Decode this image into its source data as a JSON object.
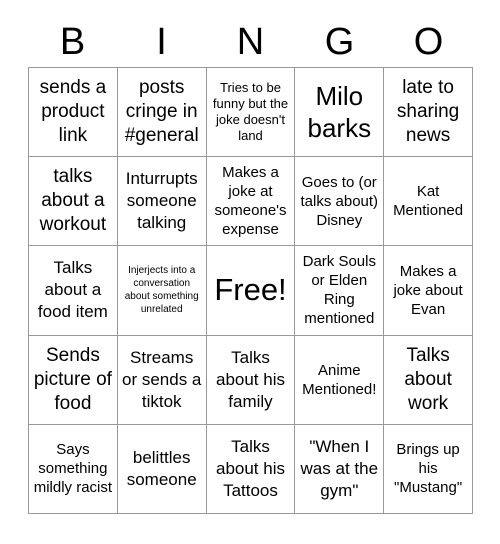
{
  "header": {
    "letters": [
      "B",
      "I",
      "N",
      "G",
      "O"
    ]
  },
  "grid": {
    "rows": 5,
    "columns": 5,
    "border_color": "#999999",
    "cell_background": "#ffffff",
    "text_color": "#000000",
    "cells": [
      {
        "text": "sends a product link",
        "size": "xl"
      },
      {
        "text": "posts cringe in #general",
        "size": "xl"
      },
      {
        "text": "Tries to be funny but the joke doesn't land",
        "size": "sm"
      },
      {
        "text": "Milo barks",
        "size": "xxl"
      },
      {
        "text": "late to sharing news",
        "size": "xl"
      },
      {
        "text": "talks about a workout",
        "size": "xl"
      },
      {
        "text": "Inturrupts someone talking",
        "size": "lg"
      },
      {
        "text": "Makes a joke at someone's expense",
        "size": "md"
      },
      {
        "text": "Goes to (or talks about) Disney",
        "size": "md"
      },
      {
        "text": "Kat Mentioned",
        "size": "md"
      },
      {
        "text": "Talks about a food item",
        "size": "lg"
      },
      {
        "text": "Injerjects into a conversation about something unrelated",
        "size": "xs"
      },
      {
        "text": "Free!",
        "size": "free"
      },
      {
        "text": "Dark Souls or Elden Ring mentioned",
        "size": "md"
      },
      {
        "text": "Makes a joke about Evan",
        "size": "md"
      },
      {
        "text": "Sends picture of food",
        "size": "xl"
      },
      {
        "text": "Streams or sends a tiktok",
        "size": "lg"
      },
      {
        "text": "Talks about his family",
        "size": "lg"
      },
      {
        "text": "Anime Mentioned!",
        "size": "md"
      },
      {
        "text": "Talks about work",
        "size": "xl"
      },
      {
        "text": "Says something mildly racist",
        "size": "md"
      },
      {
        "text": "belittles someone",
        "size": "lg"
      },
      {
        "text": "Talks about his Tattoos",
        "size": "lg"
      },
      {
        "text": "\"When I was at the gym\"",
        "size": "lg"
      },
      {
        "text": "Brings up his \"Mustang\"",
        "size": "md"
      }
    ]
  }
}
